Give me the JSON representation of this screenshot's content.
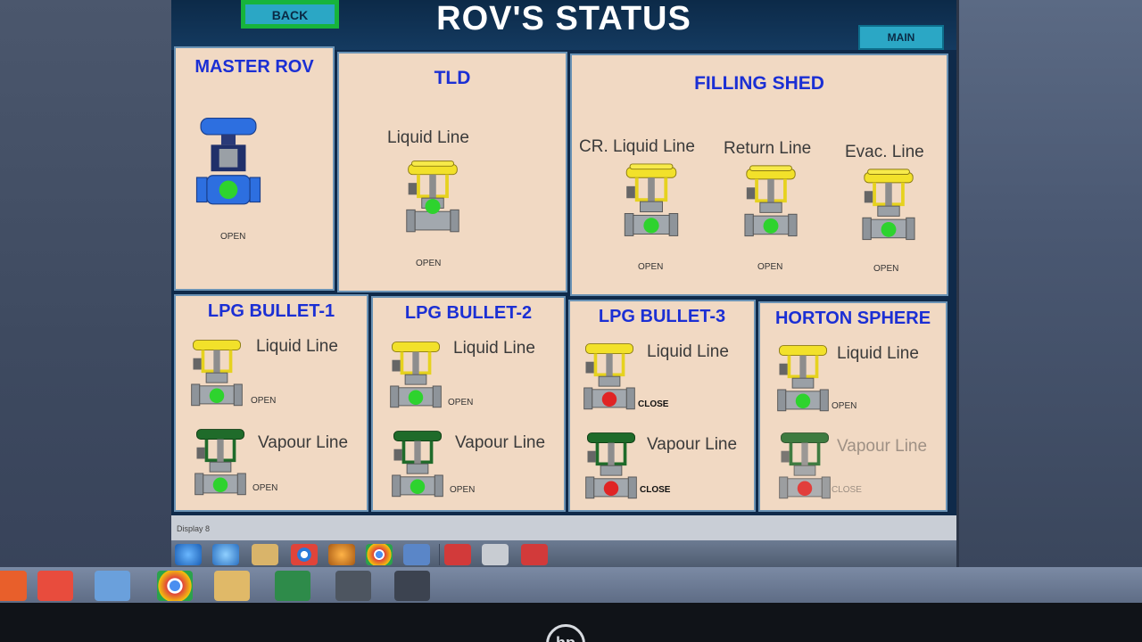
{
  "header": {
    "title": "ROV'S STATUS",
    "back_label": "BACK",
    "main_label": "MAIN"
  },
  "colors": {
    "open": "#2ed32e",
    "close": "#e02424",
    "liquid_actuator": "#f2e12a",
    "vapour_actuator": "#1f6b2a",
    "master_actuator": "#2d6fe0",
    "panel_title": "#1b2fd4"
  },
  "master_rov": {
    "title": "MASTER ROV",
    "status": "OPEN"
  },
  "tld": {
    "title": "TLD",
    "liquid_label": "Liquid Line",
    "liquid_status": "OPEN"
  },
  "filling_shed": {
    "title": "FILLING SHED",
    "lines": [
      {
        "label": "CR. Liquid Line",
        "status": "OPEN"
      },
      {
        "label": "Return Line",
        "status": "OPEN"
      },
      {
        "label": "Evac. Line",
        "status": "OPEN"
      }
    ]
  },
  "bullets": [
    {
      "title": "LPG BULLET-1",
      "liquid_label": "Liquid Line",
      "liquid_status": "OPEN",
      "vapour_label": "Vapour Line",
      "vapour_status": "OPEN"
    },
    {
      "title": "LPG BULLET-2",
      "liquid_label": "Liquid Line",
      "liquid_status": "OPEN",
      "vapour_label": "Vapour Line",
      "vapour_status": "OPEN"
    },
    {
      "title": "LPG BULLET-3",
      "liquid_label": "Liquid Line",
      "liquid_status": "CLOSE",
      "vapour_label": "Vapour Line",
      "vapour_status": "CLOSE"
    },
    {
      "title": "HORTON SPHERE",
      "liquid_label": "Liquid Line",
      "liquid_status": "OPEN",
      "vapour_label": "Vapour Line",
      "vapour_status": "CLOSE"
    }
  ],
  "statusbar": {
    "text": "Display 8"
  },
  "taskbar": {
    "inner_icons": [
      "ie-icon",
      "ie-icon",
      "folder-icon",
      "chrome-icon",
      "media-icon",
      "chrome-icon",
      "network-icon",
      "app-icon",
      "monitor-icon",
      "app-icon"
    ],
    "outer_icons": [
      "ie-icon",
      "app-icon",
      "network-icon",
      "chrome-icon",
      "folder-icon",
      "excel-icon",
      "tools-icon",
      "screen-icon"
    ]
  }
}
